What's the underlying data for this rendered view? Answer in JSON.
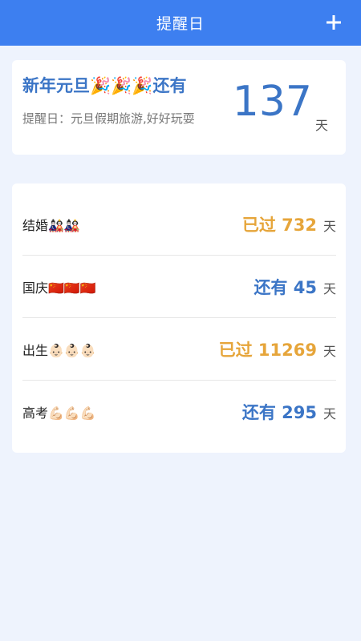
{
  "header": {
    "title": "提醒日",
    "add_icon": "plus-icon"
  },
  "highlight": {
    "title": "新年元旦🎉🎉🎉还有",
    "subtitle": "提醒日：元旦假期旅游,好好玩耍",
    "days": "137",
    "unit": "天"
  },
  "events": [
    {
      "name": "结婚🎎🎎",
      "status": "已过 732",
      "unit": "天",
      "kind": "past"
    },
    {
      "name": "国庆🇨🇳🇨🇳🇨🇳",
      "status": "还有 45",
      "unit": "天",
      "kind": "future"
    },
    {
      "name": "出生👶🏻👶🏻👶🏻",
      "status": "已过 11269",
      "unit": "天",
      "kind": "past"
    },
    {
      "name": "高考💪🏻💪🏻💪🏻",
      "status": "还有 295",
      "unit": "天",
      "kind": "future"
    }
  ],
  "colors": {
    "header_bg": "#3d7ff0",
    "page_bg": "#eef3fd",
    "accent_blue": "#3b75c6",
    "accent_orange": "#e6a53a"
  }
}
